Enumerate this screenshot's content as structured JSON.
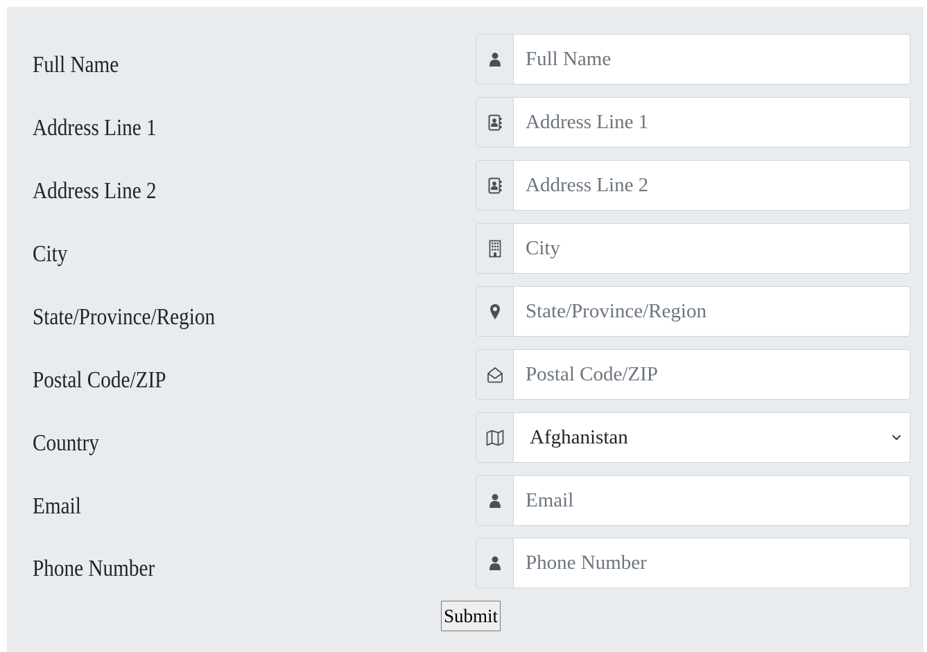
{
  "form": {
    "fields": [
      {
        "label": "Full Name",
        "placeholder": "Full Name",
        "icon": "user-icon"
      },
      {
        "label": "Address Line 1",
        "placeholder": "Address Line 1",
        "icon": "address-book-icon"
      },
      {
        "label": "Address Line 2",
        "placeholder": "Address Line 2",
        "icon": "address-book-icon"
      },
      {
        "label": "City",
        "placeholder": "City",
        "icon": "building-icon"
      },
      {
        "label": "State/Province/Region",
        "placeholder": "State/Province/Region",
        "icon": "map-pin-icon"
      },
      {
        "label": "Postal Code/ZIP",
        "placeholder": "Postal Code/ZIP",
        "icon": "envelope-open-icon"
      },
      {
        "label": "Country",
        "selected": "Afghanistan",
        "icon": "map-icon"
      },
      {
        "label": "Email",
        "placeholder": "Email",
        "icon": "user-icon"
      },
      {
        "label": "Phone Number",
        "placeholder": "Phone Number",
        "icon": "user-icon"
      }
    ],
    "submit_label": "Submit"
  },
  "colors": {
    "panel_bg": "#e9ecef",
    "border": "#ced4da",
    "icon": "#495057",
    "placeholder": "#6c757d"
  }
}
